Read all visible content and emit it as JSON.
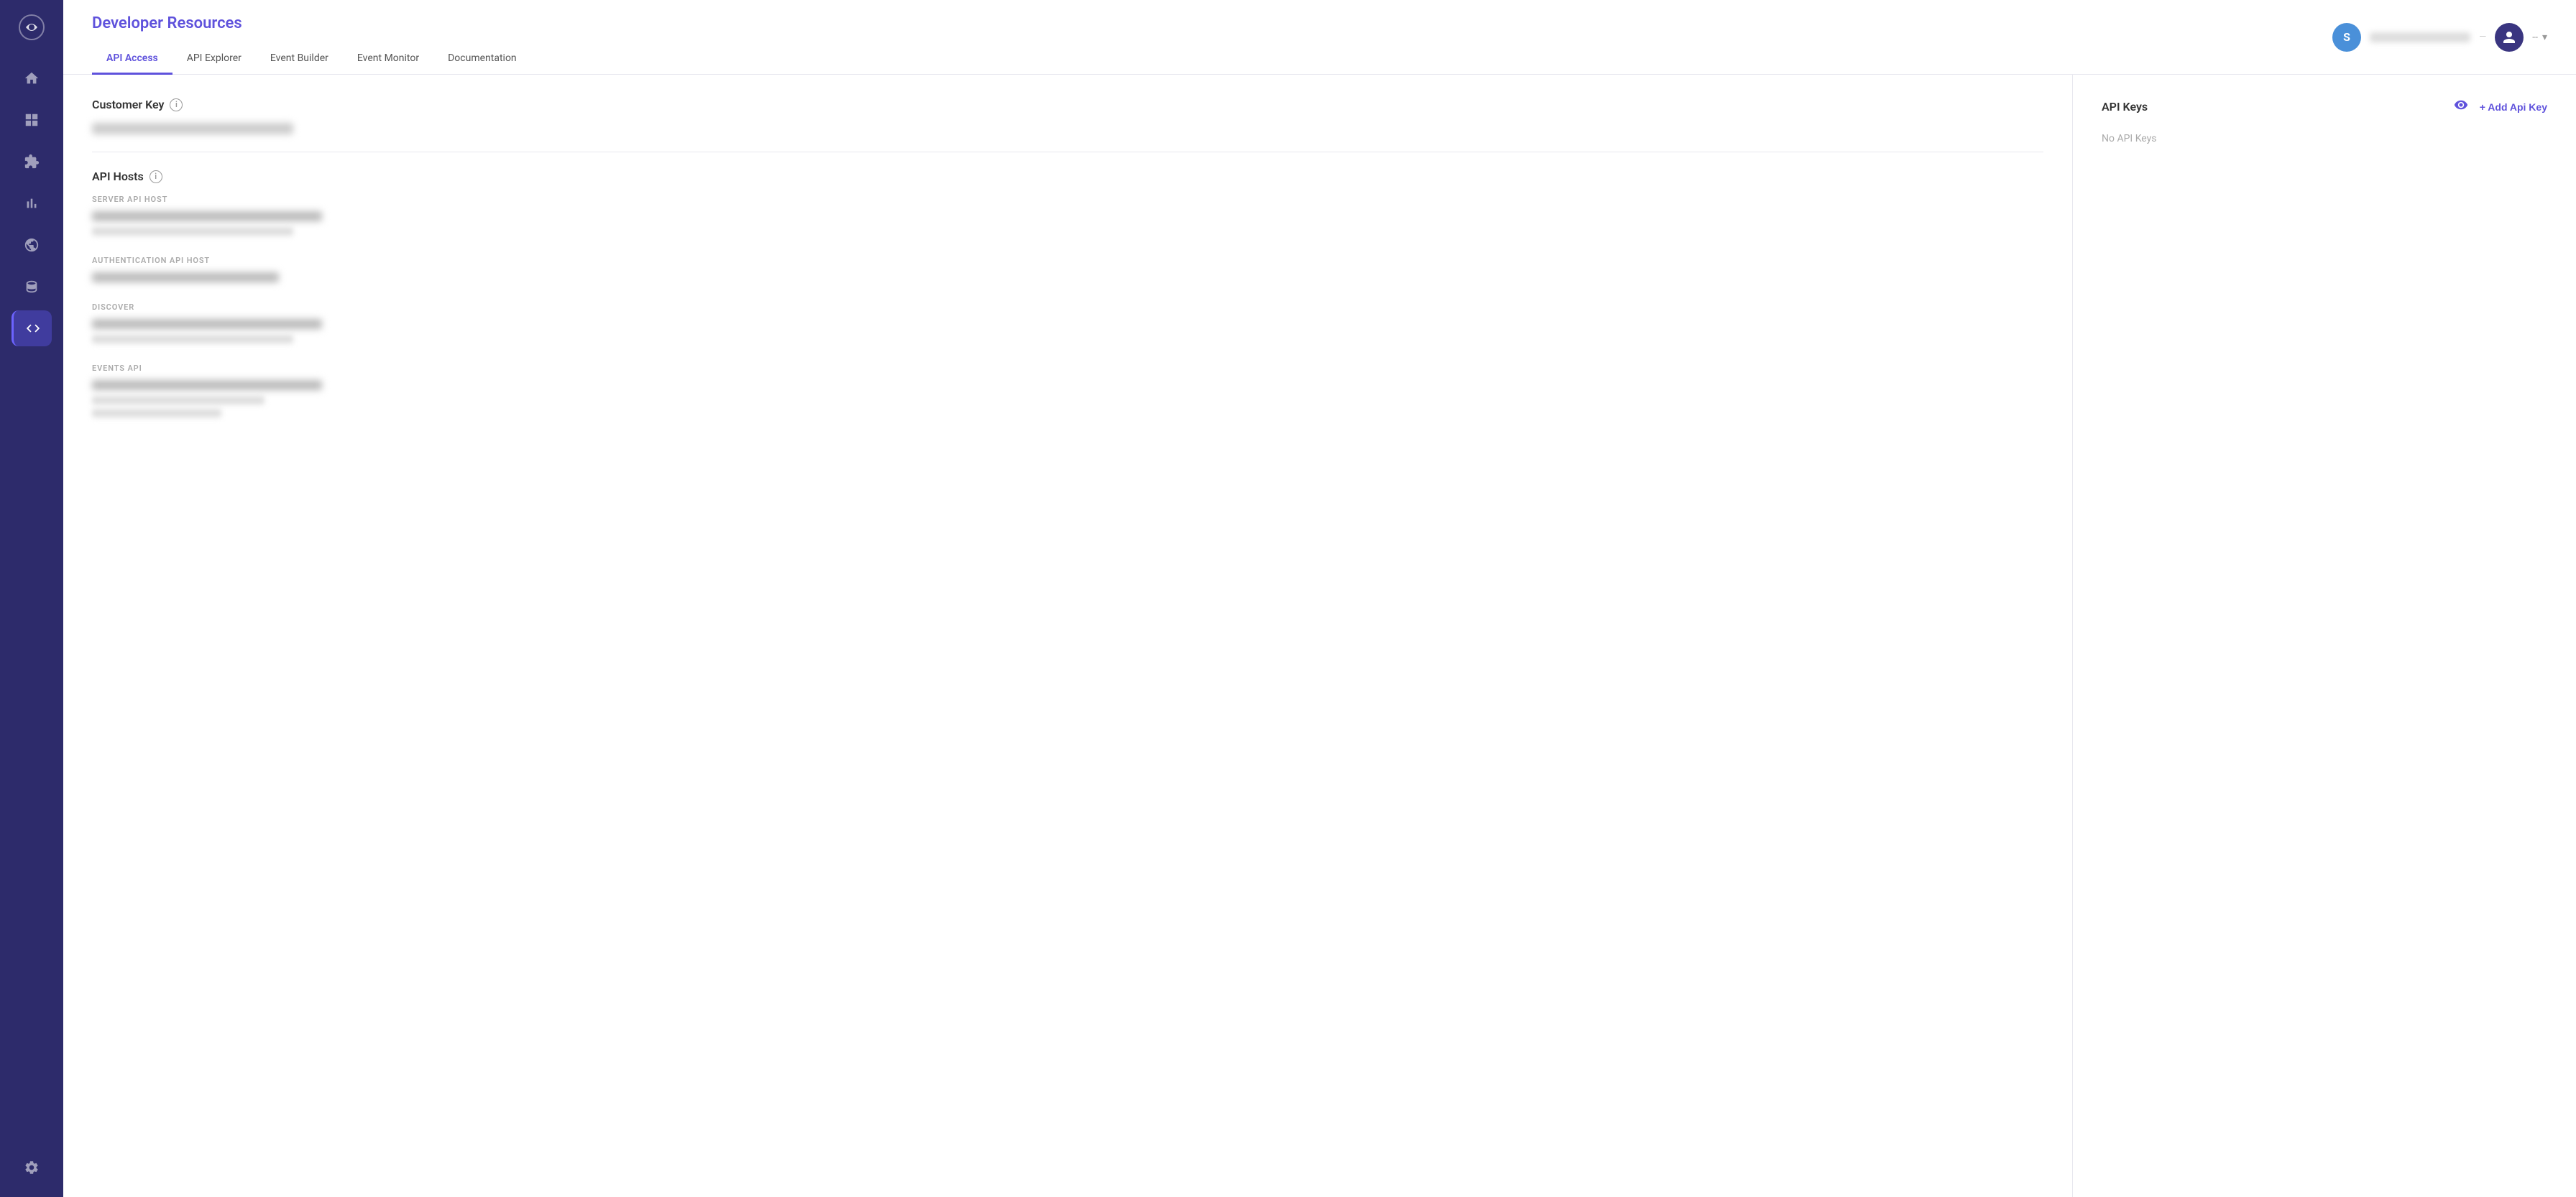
{
  "sidebar": {
    "logo_alt": "App Logo",
    "nav_items": [
      {
        "id": "home",
        "label": "Home",
        "active": false
      },
      {
        "id": "dashboard",
        "label": "Dashboard",
        "active": false
      },
      {
        "id": "integrations",
        "label": "Integrations",
        "active": false
      },
      {
        "id": "analytics",
        "label": "Analytics",
        "active": false
      },
      {
        "id": "global",
        "label": "Global",
        "active": false
      },
      {
        "id": "database",
        "label": "Database",
        "active": false
      },
      {
        "id": "developer",
        "label": "Developer",
        "active": true
      }
    ],
    "bottom_items": [
      {
        "id": "settings",
        "label": "Settings",
        "active": false
      }
    ]
  },
  "header": {
    "title": "Developer Resources",
    "user_avatar_letter": "S",
    "user_name_placeholder": "Username blurred",
    "dropdown_label": "--"
  },
  "tabs": [
    {
      "id": "api-access",
      "label": "API Access",
      "active": true
    },
    {
      "id": "api-explorer",
      "label": "API Explorer",
      "active": false
    },
    {
      "id": "event-builder",
      "label": "Event Builder",
      "active": false
    },
    {
      "id": "event-monitor",
      "label": "Event Monitor",
      "active": false
    },
    {
      "id": "documentation",
      "label": "Documentation",
      "active": false
    }
  ],
  "left_panel": {
    "customer_key": {
      "title": "Customer Key",
      "info_tooltip": "Info about Customer Key"
    },
    "api_hosts": {
      "title": "API Hosts",
      "info_tooltip": "Info about API Hosts",
      "sections": [
        {
          "id": "server-api-host",
          "label": "SERVER API HOST"
        },
        {
          "id": "authentication-api-host",
          "label": "AUTHENTICATION API HOST"
        },
        {
          "id": "discover",
          "label": "DISCOVER"
        },
        {
          "id": "events-api",
          "label": "EVENTS API"
        }
      ]
    }
  },
  "right_panel": {
    "api_keys": {
      "title": "API Keys",
      "add_button_label": "+ Add Api Key",
      "no_keys_message": "No API Keys"
    }
  }
}
